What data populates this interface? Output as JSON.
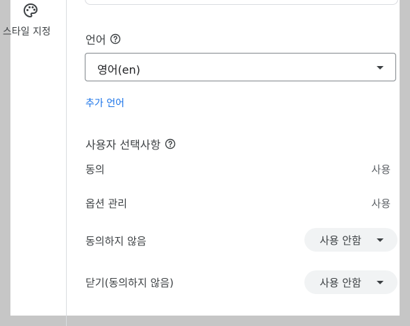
{
  "sidebar": {
    "items": [
      {
        "label": "스타일 지정",
        "icon": "palette-icon"
      }
    ]
  },
  "language": {
    "title": "언어",
    "help_icon": "help-icon",
    "select_value": "영어(en)",
    "add_language_link": "추가 언어"
  },
  "user_preferences": {
    "title": "사용자 선택사항",
    "help_icon": "help-icon",
    "rows": [
      {
        "label": "동의",
        "value": "사용"
      },
      {
        "label": "옵션 관리",
        "value": "사용"
      },
      {
        "label": "동의하지 않음",
        "value": "사용 안함"
      },
      {
        "label": "닫기(동의하지 않음)",
        "value": "사용 안함"
      }
    ]
  },
  "colors": {
    "link": "#1a73e8",
    "background": "#c6c6c6",
    "pill": "#f1f3f4"
  }
}
